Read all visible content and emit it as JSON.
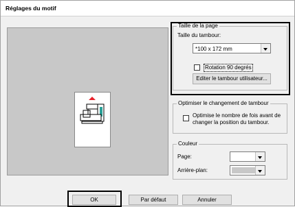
{
  "dialog": {
    "title": "Réglages du motif"
  },
  "page_size": {
    "group_label": "Taille de la page",
    "hoop_label": "Taille du tambour:",
    "hoop_value": "*100 x 172 mm",
    "rotate_label": "Rotation 90 degrés",
    "rotate_checked": false,
    "edit_button": "Editer le tambour utilisateur..."
  },
  "optimize": {
    "group_label": "Optimiser le changement de tambour",
    "line1": "Optimise le nombre de fois avant de",
    "line2": "changer la position du tambour.",
    "checked": false
  },
  "color": {
    "group_label": "Couleur",
    "page_label": "Page:",
    "page_color": "#ffffff",
    "background_label": "Arrière-plan:",
    "background_color": "#c8c8c8"
  },
  "buttons": {
    "ok": "OK",
    "default": "Par défaut",
    "cancel": "Annuler"
  },
  "colors": {
    "preview_bg": "#c8c8c8",
    "arrow": "#e8212b",
    "accent_teal": "#2aa198"
  }
}
